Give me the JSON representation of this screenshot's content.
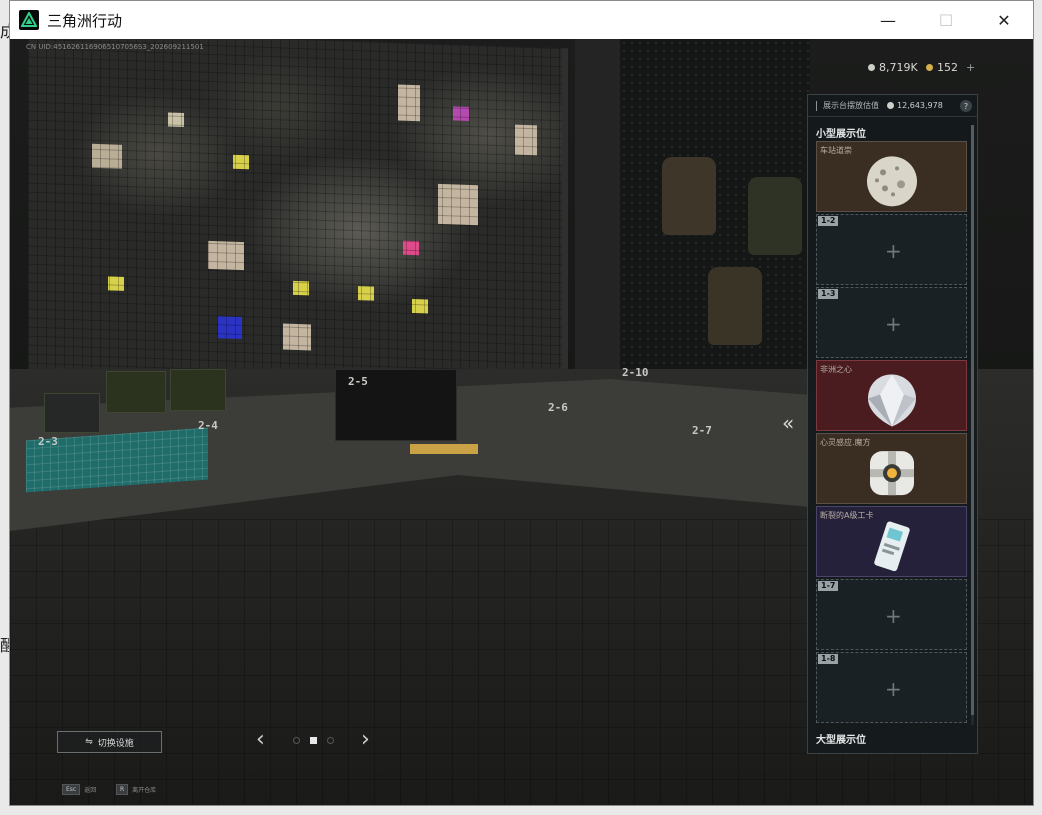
{
  "window": {
    "title": "三角洲行动",
    "minimize": "—",
    "maximize": "☐",
    "close": "✕"
  },
  "hud": {
    "uid": "CN UID:4516261169065107056S3_202609211501",
    "currency_silver": "8,719K",
    "currency_gold": "152",
    "currency_add": "+"
  },
  "scene_labels": [
    "2-3",
    "2-4",
    "2-5",
    "2-6",
    "2-7",
    "2-10"
  ],
  "panel": {
    "header_label": "展示台摆放估值",
    "header_value": "12,643,978",
    "help": "?",
    "small_section": "小型展示位",
    "large_section": "大型展示位",
    "slots": [
      {
        "name": "车站道崇",
        "num": "",
        "color": "brown",
        "item": "moon-orb"
      },
      {
        "name": "",
        "num": "1-2",
        "color": "empty",
        "item": ""
      },
      {
        "name": "",
        "num": "1-3",
        "color": "empty",
        "item": ""
      },
      {
        "name": "非洲之心",
        "num": "",
        "color": "red",
        "item": "diamond"
      },
      {
        "name": "心灵感应.魔方",
        "num": "",
        "color": "brown",
        "item": "cube"
      },
      {
        "name": "断裂的A级工卡",
        "num": "",
        "color": "purple",
        "item": "keycard"
      },
      {
        "name": "",
        "num": "1-7",
        "color": "empty",
        "item": ""
      },
      {
        "name": "",
        "num": "1-8",
        "color": "empty",
        "item": ""
      }
    ],
    "plus": "+"
  },
  "controls": {
    "switch_label": "切换设施",
    "prev": "‹",
    "next": "›",
    "collapse": "«",
    "hint_esc_key": "Esc",
    "hint_esc": "返回",
    "hint_r_key": "R",
    "hint_r": "离开仓库"
  },
  "outside": {
    "char1": "成",
    "char2": "醒"
  }
}
